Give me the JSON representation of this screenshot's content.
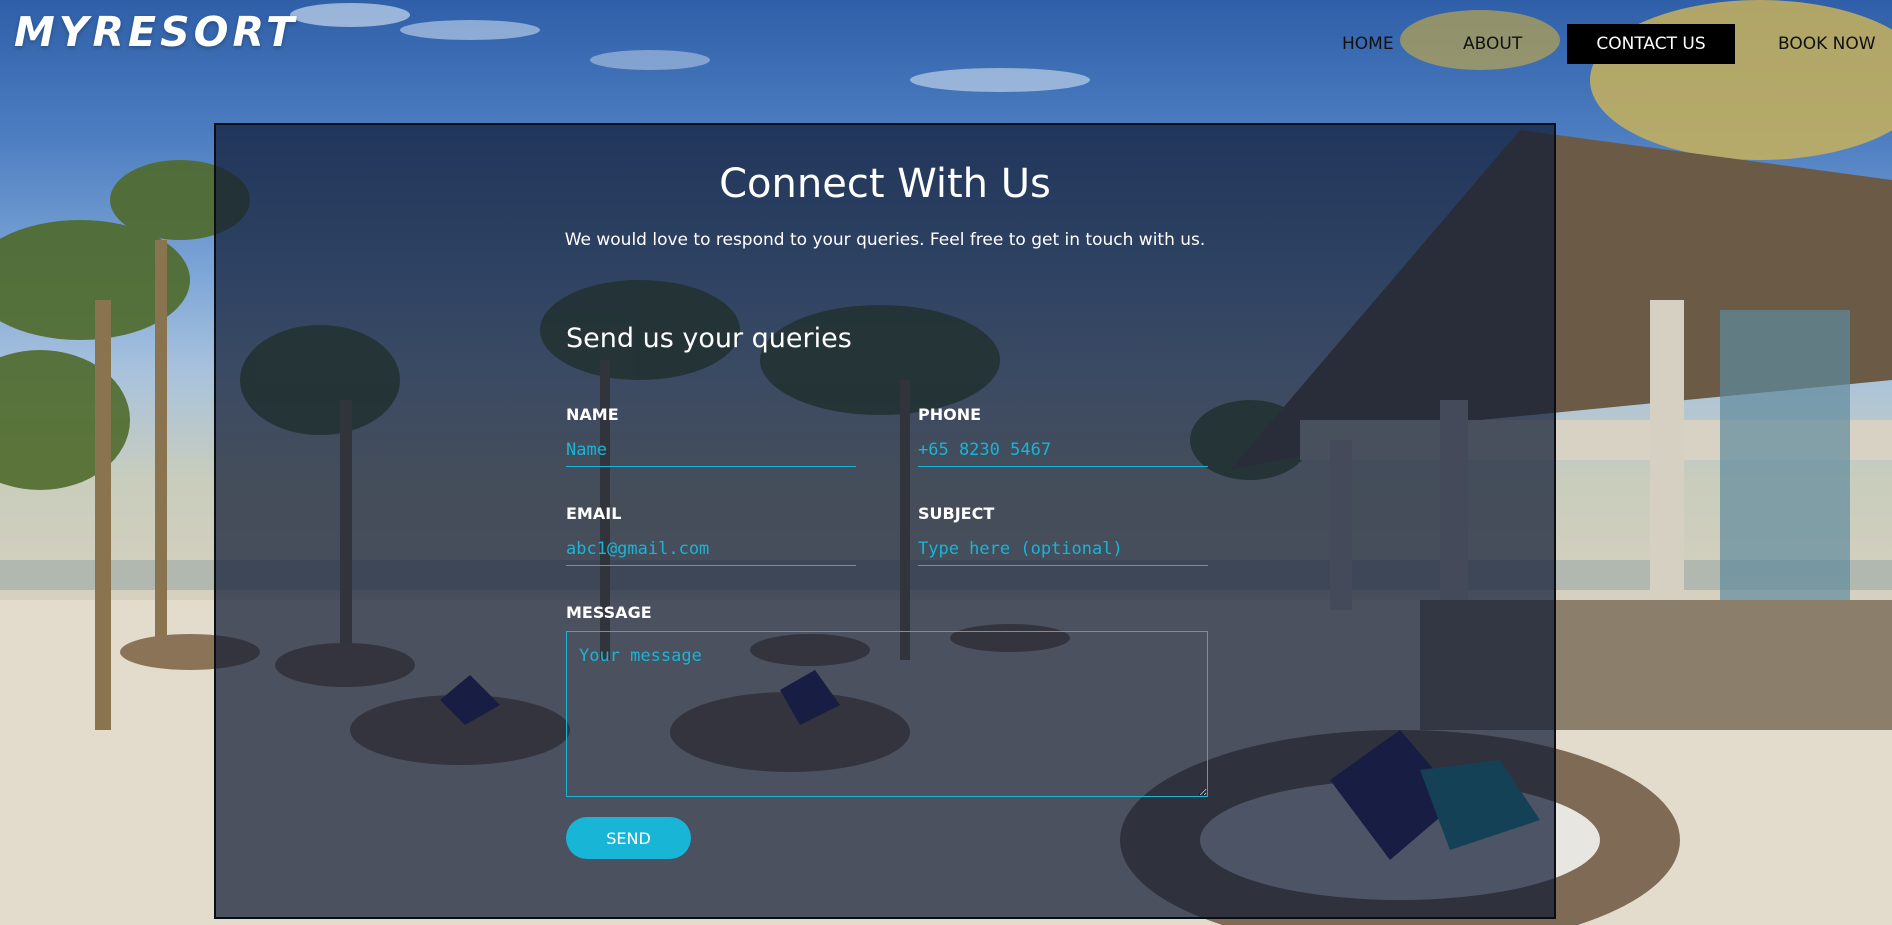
{
  "brand": {
    "logo_text": "MYRESORT"
  },
  "nav": {
    "items": [
      {
        "label": "HOME"
      },
      {
        "label": "ABOUT"
      },
      {
        "label": "CONTACT US",
        "active": true
      },
      {
        "label": "BOOK NOW"
      }
    ]
  },
  "contact": {
    "heading": "Connect With Us",
    "subheading": "We would love to respond to your queries. Feel free to get in touch with us.",
    "form_title": "Send us your queries",
    "fields": {
      "name": {
        "label": "NAME",
        "placeholder": "Name"
      },
      "phone": {
        "label": "PHONE",
        "placeholder": "+65 8230 5467"
      },
      "email": {
        "label": "EMAIL",
        "placeholder": "abc1@gmail.com"
      },
      "subject": {
        "label": "SUBJECT",
        "placeholder": "Type here (optional)"
      },
      "message": {
        "label": "MESSAGE",
        "placeholder": "Your message"
      }
    },
    "send_label": "SEND"
  },
  "colors": {
    "accent": "#18b5d6",
    "nav_active_bg": "#000000",
    "panel_overlay": "#101c34"
  }
}
